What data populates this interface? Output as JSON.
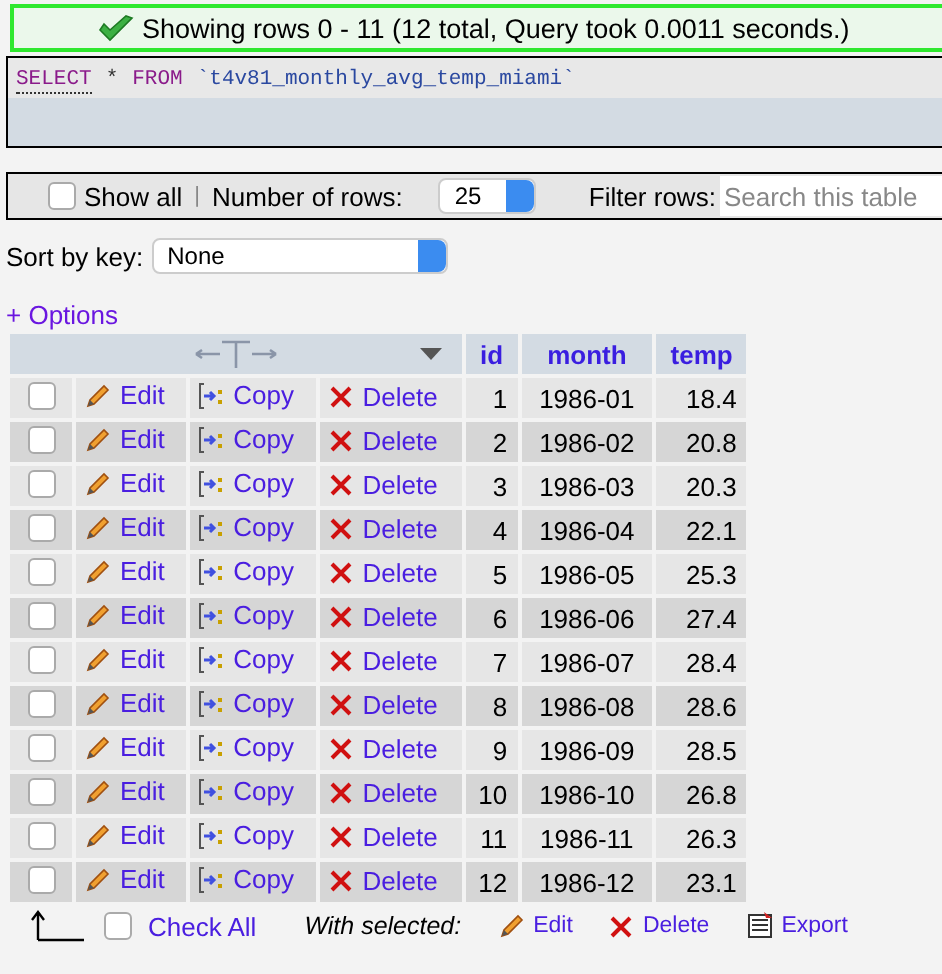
{
  "message": "Showing rows 0 - 11 (12 total, Query took 0.0011 seconds.)",
  "query": {
    "keyword_select": "SELECT",
    "star": "*",
    "keyword_from": "FROM",
    "table": "`t4v81_monthly_avg_temp_miami`"
  },
  "controls": {
    "show_all": {
      "label": "Show all",
      "checked": false
    },
    "separator": "|",
    "rows_label": "Number of rows:",
    "rows_value": "25",
    "filter_label": "Filter rows:",
    "filter_placeholder": "Search this table"
  },
  "sort": {
    "label": "Sort by key:",
    "value": "None"
  },
  "options_link": "+ Options",
  "table": {
    "columns": [
      "id",
      "month",
      "temp"
    ],
    "rows": [
      {
        "checked": false,
        "edit": "Edit",
        "copy": "Copy",
        "delete": "Delete",
        "cells": [
          "1",
          "1986-01",
          "18.4"
        ]
      },
      {
        "checked": false,
        "edit": "Edit",
        "copy": "Copy",
        "delete": "Delete",
        "cells": [
          "2",
          "1986-02",
          "20.8"
        ]
      },
      {
        "checked": false,
        "edit": "Edit",
        "copy": "Copy",
        "delete": "Delete",
        "cells": [
          "3",
          "1986-03",
          "20.3"
        ]
      },
      {
        "checked": false,
        "edit": "Edit",
        "copy": "Copy",
        "delete": "Delete",
        "cells": [
          "4",
          "1986-04",
          "22.1"
        ]
      },
      {
        "checked": false,
        "edit": "Edit",
        "copy": "Copy",
        "delete": "Delete",
        "cells": [
          "5",
          "1986-05",
          "25.3"
        ]
      },
      {
        "checked": false,
        "edit": "Edit",
        "copy": "Copy",
        "delete": "Delete",
        "cells": [
          "6",
          "1986-06",
          "27.4"
        ]
      },
      {
        "checked": false,
        "edit": "Edit",
        "copy": "Copy",
        "delete": "Delete",
        "cells": [
          "7",
          "1986-07",
          "28.4"
        ]
      },
      {
        "checked": false,
        "edit": "Edit",
        "copy": "Copy",
        "delete": "Delete",
        "cells": [
          "8",
          "1986-08",
          "28.6"
        ]
      },
      {
        "checked": false,
        "edit": "Edit",
        "copy": "Copy",
        "delete": "Delete",
        "cells": [
          "9",
          "1986-09",
          "28.5"
        ]
      },
      {
        "checked": false,
        "edit": "Edit",
        "copy": "Copy",
        "delete": "Delete",
        "cells": [
          "10",
          "1986-10",
          "26.8"
        ]
      },
      {
        "checked": false,
        "edit": "Edit",
        "copy": "Copy",
        "delete": "Delete",
        "cells": [
          "11",
          "1986-11",
          "26.3"
        ]
      },
      {
        "checked": false,
        "edit": "Edit",
        "copy": "Copy",
        "delete": "Delete",
        "cells": [
          "12",
          "1986-12",
          "23.1"
        ]
      }
    ]
  },
  "footer": {
    "check_all": {
      "label": "Check All",
      "checked": false
    },
    "with_selected": "With selected:",
    "edit": "Edit",
    "delete": "Delete",
    "export": "Export"
  }
}
